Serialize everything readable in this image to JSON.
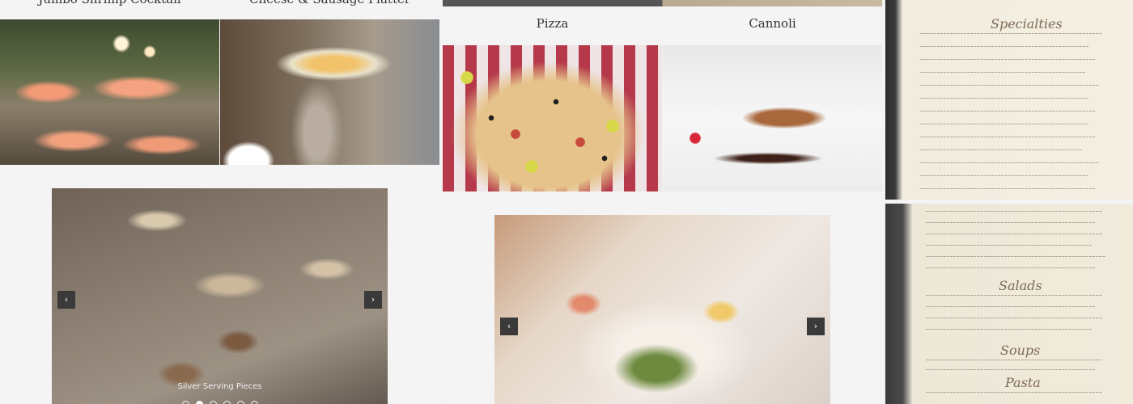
{
  "col1": {
    "top_left_caption": "Jumbo Shrimp Cocktail",
    "top_right_caption": "Cheese & Sausage Platter",
    "carousel": {
      "caption": "Silver Serving Pieces",
      "dot_count": 6,
      "active_dot": 2,
      "prev_label": "‹",
      "next_label": "›"
    }
  },
  "col2": {
    "caption_left": "Pizza",
    "caption_right": "Cannoli",
    "carousel": {
      "prev_label": "‹",
      "next_label": "›"
    }
  },
  "col3": {
    "menu1_heading": "Specialties",
    "menu2_heading_a": "Salads",
    "menu2_heading_b": "Soups",
    "menu2_heading_c": "Pasta"
  }
}
